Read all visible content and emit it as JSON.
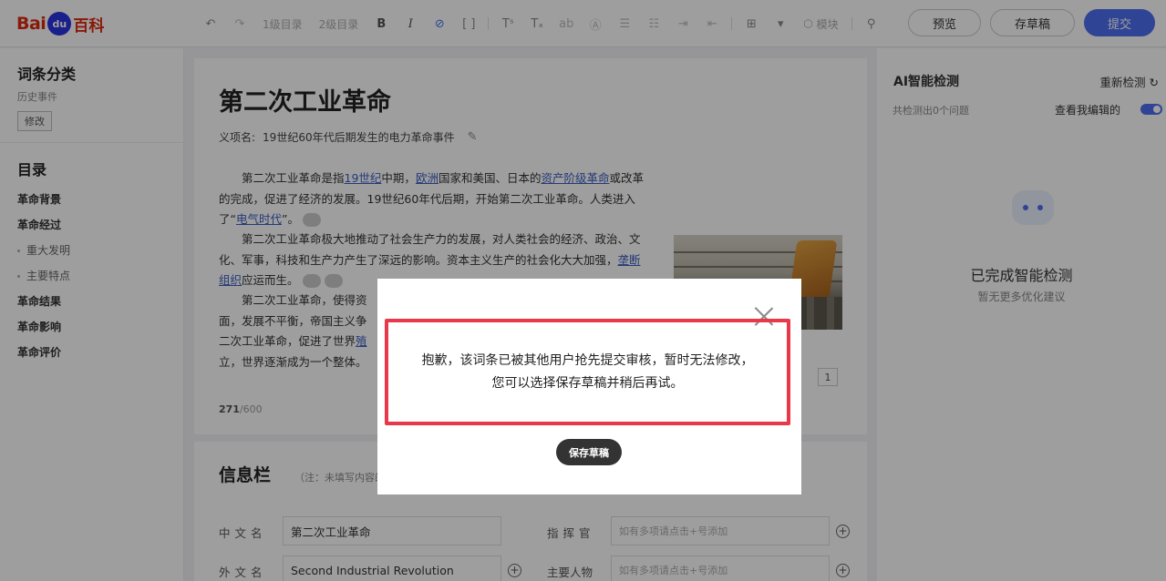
{
  "logo": {
    "bai": "Bai",
    "du": "du",
    "baike": "百科"
  },
  "toolbar": {
    "heading1": "1级目录",
    "heading2": "2级目录",
    "bold": "B",
    "italic": "I",
    "module": "模块",
    "preview": "预览",
    "save_draft": "存草稿",
    "submit": "提交"
  },
  "sidebar": {
    "category_title": "词条分类",
    "category_value": "历史事件",
    "edit_label": "修改",
    "toc_title": "目录",
    "toc": [
      {
        "label": "革命背景",
        "sub": false
      },
      {
        "label": "革命经过",
        "sub": false
      },
      {
        "label": "重大发明",
        "sub": true
      },
      {
        "label": "主要特点",
        "sub": true
      },
      {
        "label": "革命结果",
        "sub": false
      },
      {
        "label": "革命影响",
        "sub": false
      },
      {
        "label": "革命评价",
        "sub": false
      }
    ]
  },
  "article": {
    "title": "第二次工业革命",
    "meaning_label": "义项名:",
    "meaning_value": "19世纪60年代后期发生的电力革命事件",
    "p1_a": "第二次工业革命是指",
    "p1_link1": "19世纪",
    "p1_b": "中期，",
    "p1_link2": "欧洲",
    "p1_c": "国家和美国、日本的",
    "p1_link3": "资产阶级革命",
    "p1_d": "或改革的完成，促进了经济的发展。19世纪60年代后期，开始第二次工业革命。人类进入了“",
    "p1_link4": "电气时代",
    "p1_e": "”。",
    "p2_a": "第二次工业革命极大地推动了社会生产力的发展，对人类社会的经济、政治、文化、军事，科技和生产力产生了深远的影响。资本主义生产的社会化大大加强，",
    "p2_link": "垄断组织",
    "p2_b": "应运而生。",
    "p3_a": "第二次工业革命，使得资",
    "p3_b": "面，发展不平衡，帝国主义争",
    "p3_c": "二次工业革命，促进了世界",
    "p3_link": "殖",
    "p3_d": "立，世界逐渐成为一个整体。",
    "photo_count": "1",
    "char_count": "271",
    "char_total": "/600"
  },
  "infobox": {
    "title": "信息栏",
    "note": "（注：未填写内容的",
    "fields": {
      "cn_name_label": "中文名",
      "cn_name_value": "第二次工业革命",
      "en_name_label": "外文名",
      "en_name_value": "Second Industrial Revolution",
      "commander_label": "指挥官",
      "commander_placeholder": "如有多项请点击+号添加",
      "main_people_label": "主要人物",
      "main_people_placeholder": "如有多项请点击+号添加"
    }
  },
  "ai_panel": {
    "title": "AI智能检测",
    "recheck": "重新检测",
    "issues": "共检测出0个问题",
    "view_mine": "查看我编辑的",
    "done": "已完成智能检测",
    "no_suggestion": "暂无更多优化建议"
  },
  "modal": {
    "line1": "抱歉，该词条已被其他用户抢先提交审核，暂时无法修改，",
    "line2": "您可以选择保存草稿并稍后再试。",
    "save_draft": "保存草稿"
  },
  "colors": {
    "accent": "#4e6ef2",
    "brand_red": "#de2910",
    "highlight_border": "#e8384a"
  }
}
